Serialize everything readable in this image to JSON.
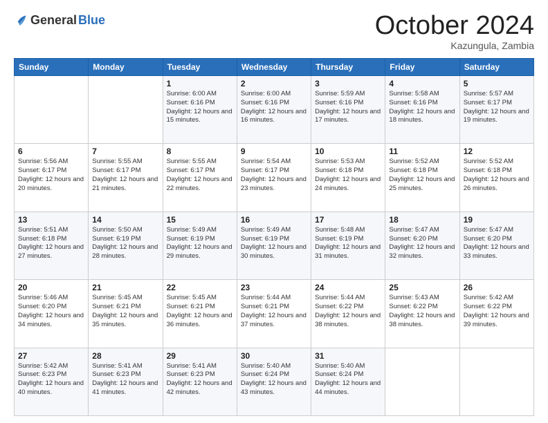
{
  "logo": {
    "general": "General",
    "blue": "Blue"
  },
  "header": {
    "month": "October 2024",
    "location": "Kazungula, Zambia"
  },
  "weekdays": [
    "Sunday",
    "Monday",
    "Tuesday",
    "Wednesday",
    "Thursday",
    "Friday",
    "Saturday"
  ],
  "weeks": [
    [
      {
        "day": "",
        "info": ""
      },
      {
        "day": "",
        "info": ""
      },
      {
        "day": "1",
        "info": "Sunrise: 6:00 AM\nSunset: 6:16 PM\nDaylight: 12 hours and 15 minutes."
      },
      {
        "day": "2",
        "info": "Sunrise: 6:00 AM\nSunset: 6:16 PM\nDaylight: 12 hours and 16 minutes."
      },
      {
        "day": "3",
        "info": "Sunrise: 5:59 AM\nSunset: 6:16 PM\nDaylight: 12 hours and 17 minutes."
      },
      {
        "day": "4",
        "info": "Sunrise: 5:58 AM\nSunset: 6:16 PM\nDaylight: 12 hours and 18 minutes."
      },
      {
        "day": "5",
        "info": "Sunrise: 5:57 AM\nSunset: 6:17 PM\nDaylight: 12 hours and 19 minutes."
      }
    ],
    [
      {
        "day": "6",
        "info": "Sunrise: 5:56 AM\nSunset: 6:17 PM\nDaylight: 12 hours and 20 minutes."
      },
      {
        "day": "7",
        "info": "Sunrise: 5:55 AM\nSunset: 6:17 PM\nDaylight: 12 hours and 21 minutes."
      },
      {
        "day": "8",
        "info": "Sunrise: 5:55 AM\nSunset: 6:17 PM\nDaylight: 12 hours and 22 minutes."
      },
      {
        "day": "9",
        "info": "Sunrise: 5:54 AM\nSunset: 6:17 PM\nDaylight: 12 hours and 23 minutes."
      },
      {
        "day": "10",
        "info": "Sunrise: 5:53 AM\nSunset: 6:18 PM\nDaylight: 12 hours and 24 minutes."
      },
      {
        "day": "11",
        "info": "Sunrise: 5:52 AM\nSunset: 6:18 PM\nDaylight: 12 hours and 25 minutes."
      },
      {
        "day": "12",
        "info": "Sunrise: 5:52 AM\nSunset: 6:18 PM\nDaylight: 12 hours and 26 minutes."
      }
    ],
    [
      {
        "day": "13",
        "info": "Sunrise: 5:51 AM\nSunset: 6:18 PM\nDaylight: 12 hours and 27 minutes."
      },
      {
        "day": "14",
        "info": "Sunrise: 5:50 AM\nSunset: 6:19 PM\nDaylight: 12 hours and 28 minutes."
      },
      {
        "day": "15",
        "info": "Sunrise: 5:49 AM\nSunset: 6:19 PM\nDaylight: 12 hours and 29 minutes."
      },
      {
        "day": "16",
        "info": "Sunrise: 5:49 AM\nSunset: 6:19 PM\nDaylight: 12 hours and 30 minutes."
      },
      {
        "day": "17",
        "info": "Sunrise: 5:48 AM\nSunset: 6:19 PM\nDaylight: 12 hours and 31 minutes."
      },
      {
        "day": "18",
        "info": "Sunrise: 5:47 AM\nSunset: 6:20 PM\nDaylight: 12 hours and 32 minutes."
      },
      {
        "day": "19",
        "info": "Sunrise: 5:47 AM\nSunset: 6:20 PM\nDaylight: 12 hours and 33 minutes."
      }
    ],
    [
      {
        "day": "20",
        "info": "Sunrise: 5:46 AM\nSunset: 6:20 PM\nDaylight: 12 hours and 34 minutes."
      },
      {
        "day": "21",
        "info": "Sunrise: 5:45 AM\nSunset: 6:21 PM\nDaylight: 12 hours and 35 minutes."
      },
      {
        "day": "22",
        "info": "Sunrise: 5:45 AM\nSunset: 6:21 PM\nDaylight: 12 hours and 36 minutes."
      },
      {
        "day": "23",
        "info": "Sunrise: 5:44 AM\nSunset: 6:21 PM\nDaylight: 12 hours and 37 minutes."
      },
      {
        "day": "24",
        "info": "Sunrise: 5:44 AM\nSunset: 6:22 PM\nDaylight: 12 hours and 38 minutes."
      },
      {
        "day": "25",
        "info": "Sunrise: 5:43 AM\nSunset: 6:22 PM\nDaylight: 12 hours and 38 minutes."
      },
      {
        "day": "26",
        "info": "Sunrise: 5:42 AM\nSunset: 6:22 PM\nDaylight: 12 hours and 39 minutes."
      }
    ],
    [
      {
        "day": "27",
        "info": "Sunrise: 5:42 AM\nSunset: 6:23 PM\nDaylight: 12 hours and 40 minutes."
      },
      {
        "day": "28",
        "info": "Sunrise: 5:41 AM\nSunset: 6:23 PM\nDaylight: 12 hours and 41 minutes."
      },
      {
        "day": "29",
        "info": "Sunrise: 5:41 AM\nSunset: 6:23 PM\nDaylight: 12 hours and 42 minutes."
      },
      {
        "day": "30",
        "info": "Sunrise: 5:40 AM\nSunset: 6:24 PM\nDaylight: 12 hours and 43 minutes."
      },
      {
        "day": "31",
        "info": "Sunrise: 5:40 AM\nSunset: 6:24 PM\nDaylight: 12 hours and 44 minutes."
      },
      {
        "day": "",
        "info": ""
      },
      {
        "day": "",
        "info": ""
      }
    ]
  ]
}
